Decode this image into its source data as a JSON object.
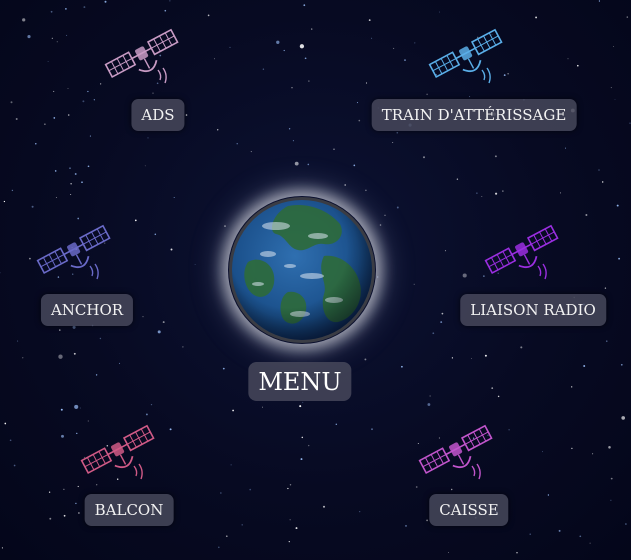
{
  "menu": {
    "label": "MENU"
  },
  "items": [
    {
      "id": "ads",
      "label": "ADS",
      "color": "#c89bc4"
    },
    {
      "id": "train",
      "label": "TRAIN D'ATTÉRISSAGE",
      "color": "#5aaee8"
    },
    {
      "id": "anchor",
      "label": "ANCHOR",
      "color": "#6a6ac8"
    },
    {
      "id": "liaison",
      "label": "LIAISON RADIO",
      "color": "#9a2ee0"
    },
    {
      "id": "balcon",
      "label": "BALCON",
      "color": "#d05a86"
    },
    {
      "id": "caisse",
      "label": "CAISSE",
      "color": "#c255cc"
    }
  ],
  "icons": {
    "satellite": "satellite-icon",
    "earth": "earth-icon"
  }
}
